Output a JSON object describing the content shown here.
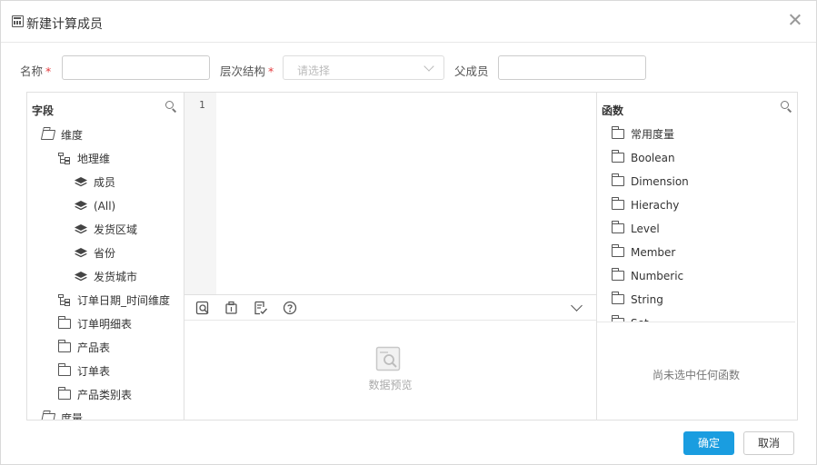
{
  "dialog": {
    "title": "新建计算成员"
  },
  "form": {
    "name_label": "名称",
    "hierarchy_label": "层次结构",
    "hierarchy_placeholder": "请选择",
    "parent_label": "父成员",
    "required_mark": "*",
    "name_value": "",
    "parent_value": ""
  },
  "fields_panel": {
    "title": "字段",
    "items": [
      {
        "label": "维度",
        "icon": "folder-open-icon"
      },
      {
        "label": "地理维",
        "icon": "hierarchy-icon"
      },
      {
        "label": "成员",
        "icon": "layers-icon"
      },
      {
        "label": "(All)",
        "icon": "layers-icon"
      },
      {
        "label": "发货区域",
        "icon": "layers-icon"
      },
      {
        "label": "省份",
        "icon": "layers-icon"
      },
      {
        "label": "发货城市",
        "icon": "layers-icon"
      },
      {
        "label": "订单日期_时间维度",
        "icon": "hierarchy-icon"
      },
      {
        "label": "订单明细表",
        "icon": "folder-icon"
      },
      {
        "label": "产品表",
        "icon": "folder-icon"
      },
      {
        "label": "订单表",
        "icon": "folder-icon"
      },
      {
        "label": "产品类别表",
        "icon": "folder-icon"
      },
      {
        "label": "度量",
        "icon": "folder-open-icon"
      }
    ]
  },
  "editor": {
    "line_number": "1",
    "code": "",
    "preview_text": "数据预览"
  },
  "functions_panel": {
    "title": "函数",
    "items": [
      "常用度量",
      "Boolean",
      "Dimension",
      "Hierachy",
      "Level",
      "Member",
      "Numberic",
      "String",
      "Set"
    ],
    "empty_text": "尚未选中任何函数"
  },
  "buttons": {
    "confirm": "确定",
    "cancel": "取消"
  },
  "colors": {
    "primary": "#1a9de0",
    "required": "#e4393c"
  }
}
